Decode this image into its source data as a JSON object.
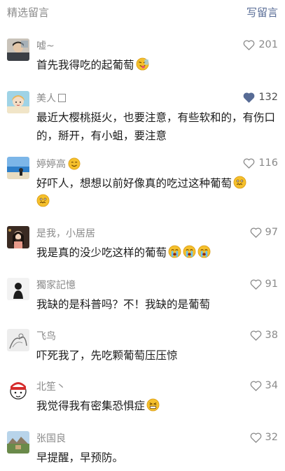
{
  "header": {
    "title": "精选留言",
    "action": "写留言"
  },
  "comments": [
    {
      "name": "嘘~",
      "likes": "201",
      "liked": false,
      "text": "首先我得吃的起葡萄",
      "avatar": "avatar-portrait-icon"
    },
    {
      "name": "美人",
      "likes": "132",
      "liked": true,
      "text": "最近大樱桃挺火，也要注意，有些软和的，有伤口的，掰开，有小蛆，要注意",
      "avatar": "avatar-cartoon-icon"
    },
    {
      "name": "婷婷高",
      "likes": "116",
      "liked": false,
      "text": "好吓人，想想以前好像真的吃过这种葡萄",
      "avatar": "avatar-beach-icon"
    },
    {
      "name": "是我，小居居",
      "likes": "97",
      "liked": false,
      "text": "我是真的没少吃这样的葡萄",
      "avatar": "avatar-girl-icon"
    },
    {
      "name": "獨家記憶",
      "likes": "91",
      "liked": false,
      "text": "我缺的是科普吗？不！我缺的是葡萄",
      "avatar": "avatar-silhouette-icon"
    },
    {
      "name": "飞鸟",
      "likes": "38",
      "liked": false,
      "text": "吓死我了，先吃颗葡萄压压惊",
      "avatar": "avatar-sketch-icon"
    },
    {
      "name": "北笙丶",
      "likes": "34",
      "liked": false,
      "text": "我觉得我有密集恐惧症",
      "avatar": "avatar-cartoon-red-icon"
    },
    {
      "name": "张国良",
      "likes": "32",
      "liked": false,
      "text": "早提醒，早预防。",
      "avatar": "avatar-landscape-icon"
    }
  ],
  "colors": {
    "link": "#576b95",
    "muted": "#8a8a8a",
    "liked_heart": "#576b95"
  }
}
